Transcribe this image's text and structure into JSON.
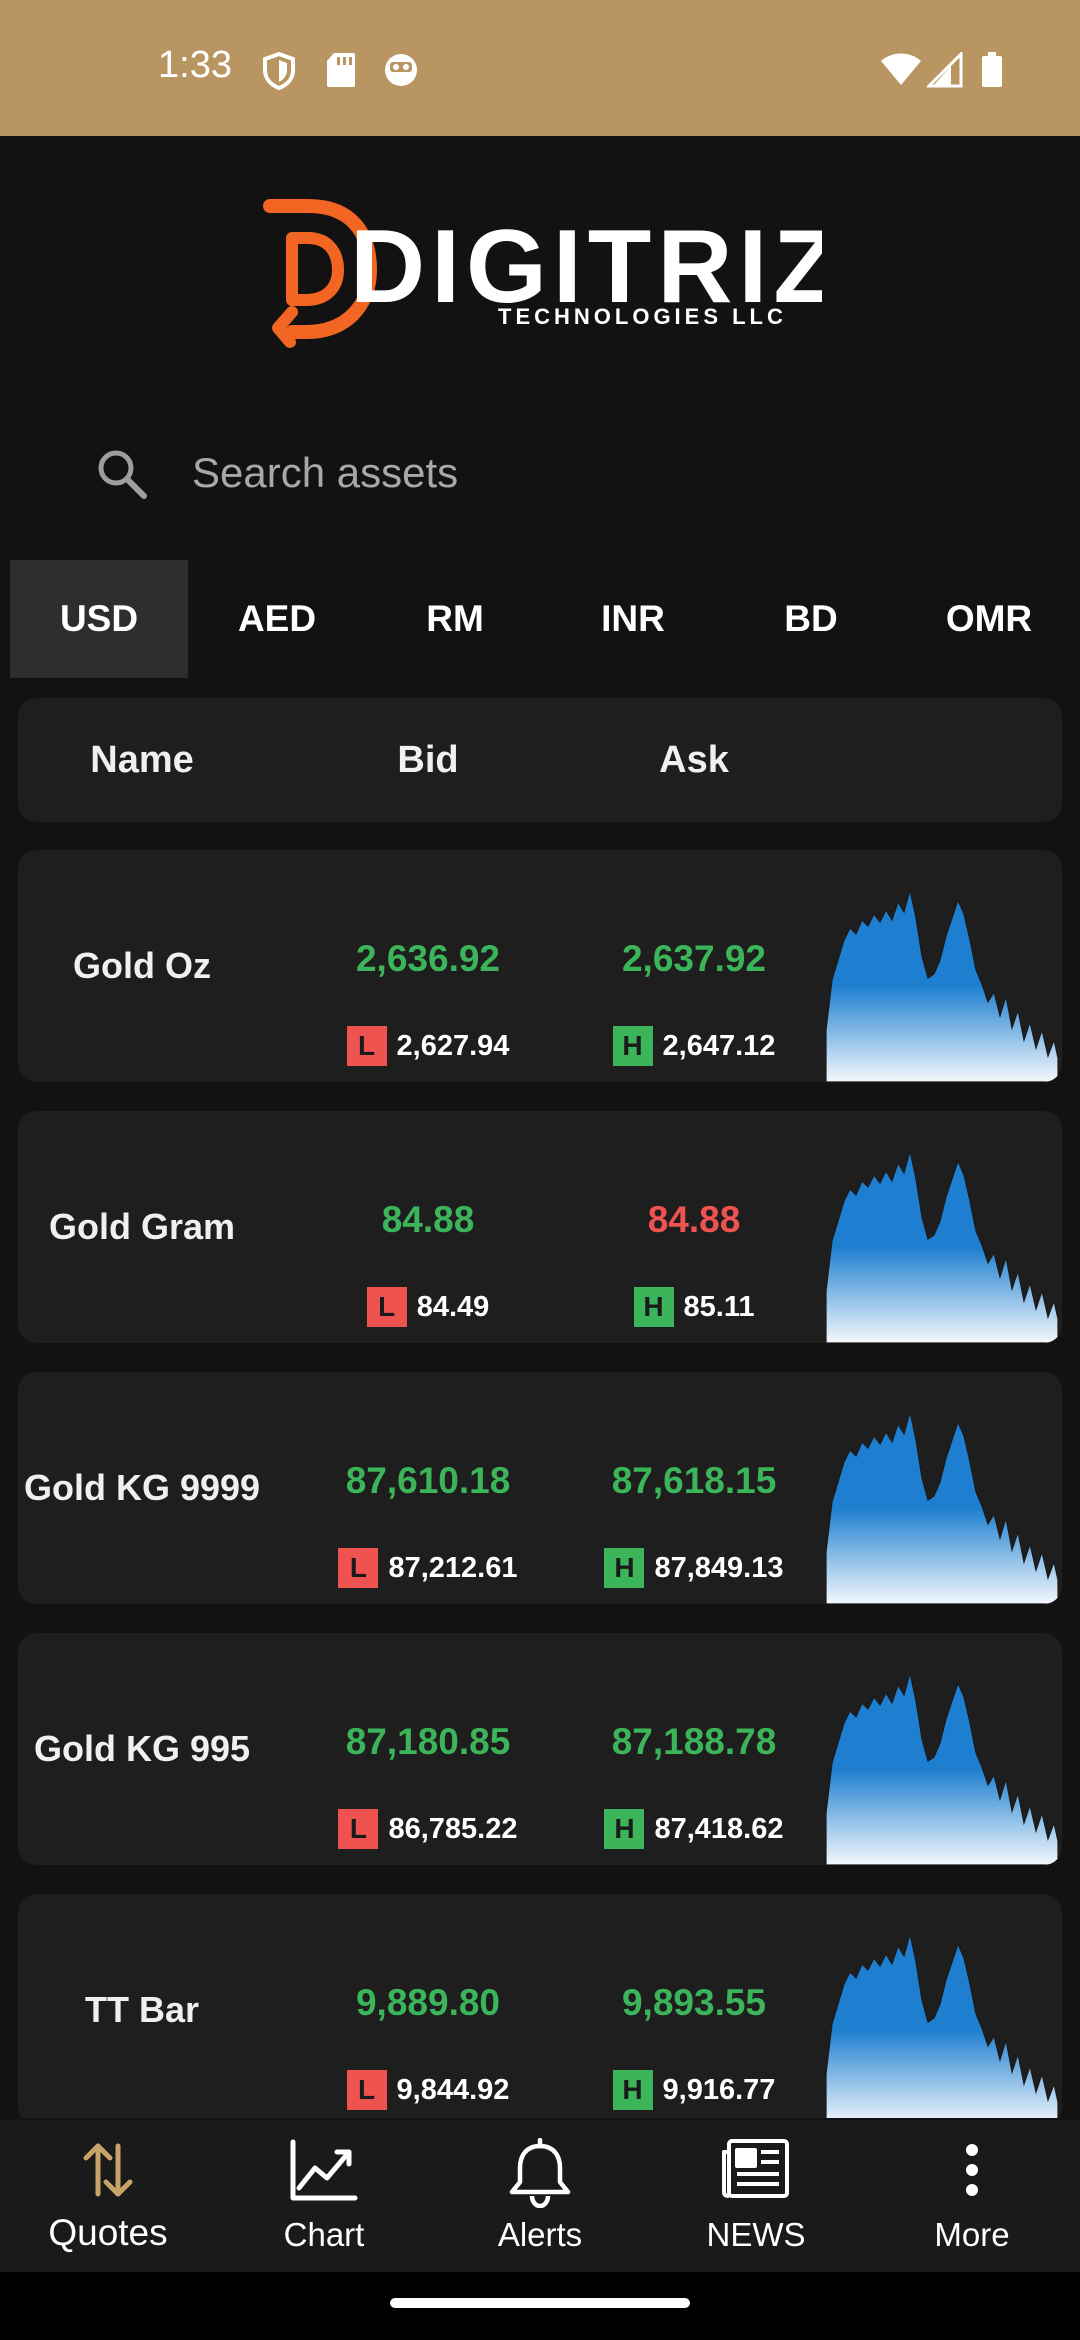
{
  "status_bar": {
    "time": "1:33",
    "bg_color": "#b99561",
    "left_icons": [
      "shield-icon",
      "sd-card-icon",
      "face-icon"
    ],
    "right_icons": [
      "wifi-icon",
      "signal-icon",
      "battery-icon"
    ]
  },
  "logo": {
    "brand": "DIGITRIZ",
    "tagline": "TECHNOLOGIES LLC",
    "accent_color": "#f26522"
  },
  "search": {
    "placeholder": "Search assets"
  },
  "tabs": [
    "USD",
    "AED",
    "RM",
    "INR",
    "BD",
    "OMR"
  ],
  "active_tab": "USD",
  "table_headers": {
    "name": "Name",
    "bid": "Bid",
    "ask": "Ask"
  },
  "quotes": [
    {
      "name": "Gold Oz",
      "bid": "2,636.92",
      "ask": "2,637.92",
      "bid_color": "green",
      "ask_color": "green",
      "low_label": "L",
      "low": "2,627.94",
      "high_label": "H",
      "high": "2,647.12"
    },
    {
      "name": "Gold Gram",
      "bid": "84.88",
      "ask": "84.88",
      "bid_color": "green",
      "ask_color": "red",
      "low_label": "L",
      "low": "84.49",
      "high_label": "H",
      "high": "85.11"
    },
    {
      "name": "Gold KG 9999",
      "bid": "87,610.18",
      "ask": "87,618.15",
      "bid_color": "green",
      "ask_color": "green",
      "low_label": "L",
      "low": "87,212.61",
      "high_label": "H",
      "high": "87,849.13"
    },
    {
      "name": "Gold KG 995",
      "bid": "87,180.85",
      "ask": "87,188.78",
      "bid_color": "green",
      "ask_color": "green",
      "low_label": "L",
      "low": "86,785.22",
      "high_label": "H",
      "high": "87,418.62"
    },
    {
      "name": "TT Bar",
      "bid": "9,889.80",
      "ask": "9,893.55",
      "bid_color": "green",
      "ask_color": "green",
      "low_label": "L",
      "low": "9,844.92",
      "high_label": "H",
      "high": "9,916.77"
    }
  ],
  "colors": {
    "green": "#3cb55a",
    "red": "#ef5350",
    "spark_blue": "#1e7fd0",
    "active_nav": "#c9a468"
  },
  "nav": [
    {
      "label": "Quotes",
      "icon": "swap-vertical-icon",
      "active": true
    },
    {
      "label": "Chart",
      "icon": "line-chart-icon",
      "active": false
    },
    {
      "label": "Alerts",
      "icon": "bell-icon",
      "active": false
    },
    {
      "label": "NEWS",
      "icon": "newspaper-icon",
      "active": false
    },
    {
      "label": "More",
      "icon": "more-vertical-icon",
      "active": false
    }
  ]
}
